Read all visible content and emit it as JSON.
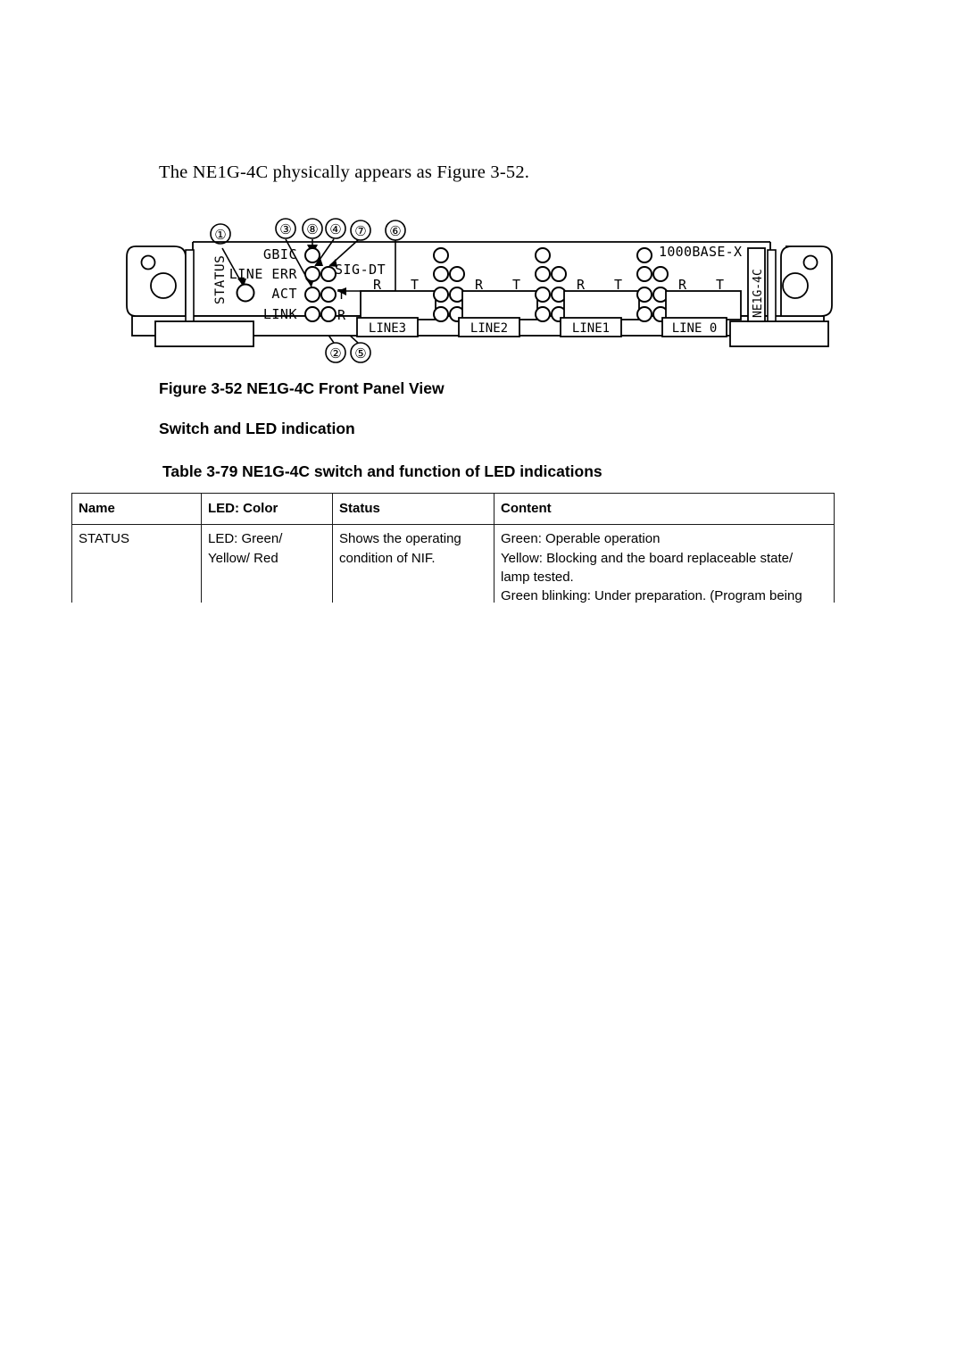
{
  "document": {
    "intro_sentence": "The NE1G-4C physically appears as Figure 3-52.",
    "figure_caption": "Figure 3-52 NE1G-4C Front Panel View",
    "section_heading": "Switch and LED indication",
    "table_caption": "Table 3-79  NE1G-4C switch and function of LED indications"
  },
  "figure": {
    "panel_label_right": "NE1G-4C",
    "interface_type": "1000BASE-X",
    "status_label": "STATUS",
    "led_labels": {
      "gbic": "GBIC",
      "line_err": "LINE ERR",
      "act": "ACT",
      "link": "LINK",
      "sig_dt": "SIG-DT",
      "t": "T",
      "r": "R"
    },
    "port_groups": [
      {
        "name": "LINE3",
        "rx": "R",
        "tx": "T"
      },
      {
        "name": "LINE2",
        "rx": "R",
        "tx": "T"
      },
      {
        "name": "LINE1",
        "rx": "R",
        "tx": "T"
      },
      {
        "name": "LINE 0",
        "rx": "R",
        "tx": "T"
      }
    ],
    "callouts": [
      {
        "id": "1",
        "glyph": "①"
      },
      {
        "id": "2",
        "glyph": "②"
      },
      {
        "id": "3",
        "glyph": "③"
      },
      {
        "id": "4",
        "glyph": "④"
      },
      {
        "id": "5",
        "glyph": "⑤"
      },
      {
        "id": "6",
        "glyph": "⑥"
      },
      {
        "id": "7",
        "glyph": "⑦"
      },
      {
        "id": "8",
        "glyph": "⑧"
      }
    ]
  },
  "table": {
    "columns": [
      "Name",
      "LED: Color",
      "Status",
      "Content"
    ],
    "rows": [
      {
        "name": [
          "STATUS"
        ],
        "color": [
          "LED: Green/",
          "Yellow/ Red"
        ],
        "status": [
          "Shows the operating",
          "condition of NIF."
        ],
        "content": [
          "Green: Operable operation",
          "Yellow: Blocking and the board replaceable state/",
          "lamp tested.",
          "Green blinking: Under preparation. (Program being"
        ]
      }
    ]
  }
}
